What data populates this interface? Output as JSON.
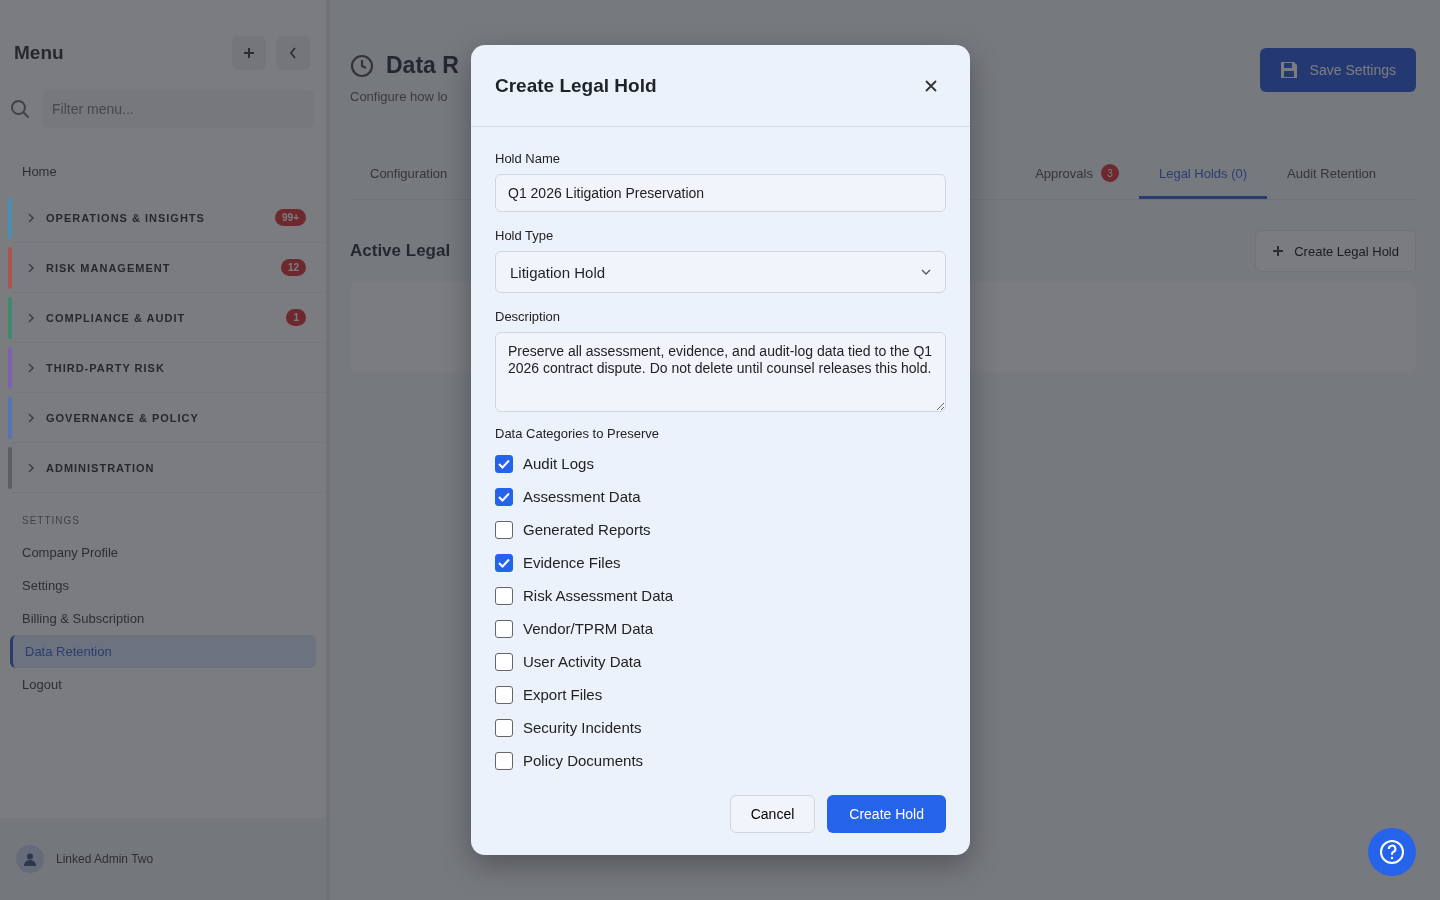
{
  "sidebar": {
    "title": "Menu",
    "filter": {
      "placeholder": "Filter menu..."
    },
    "home": "Home",
    "groups": [
      {
        "label": "OPERATIONS & INSIGHTS",
        "color": "#4a8db5",
        "badge": "99+"
      },
      {
        "label": "RISK MANAGEMENT",
        "color": "#b0504f",
        "badge": "12"
      },
      {
        "label": "COMPLIANCE & AUDIT",
        "color": "#3f8a6c",
        "badge": "1"
      },
      {
        "label": "THIRD-PARTY RISK",
        "color": "#7a62b0"
      },
      {
        "label": "GOVERNANCE & POLICY",
        "color": "#5673b8"
      },
      {
        "label": "ADMINISTRATION",
        "color": "#5a5e66"
      }
    ],
    "settings_heading": "SETTINGS",
    "links": [
      {
        "label": "Company Profile",
        "selected": false
      },
      {
        "label": "Settings",
        "selected": false
      },
      {
        "label": "Billing & Subscription",
        "selected": false
      },
      {
        "label": "Data Retention",
        "selected": true
      },
      {
        "label": "Logout",
        "selected": false
      }
    ],
    "user": "Linked Admin Two"
  },
  "page": {
    "title": "Data R",
    "subtitle": "Configure how lo",
    "save_button": "Save Settings",
    "tabs": [
      {
        "label": "Configuration",
        "selected": false
      },
      {
        "label": "Approvals",
        "badge": "3",
        "selected": false
      },
      {
        "label": "Legal Holds (0)",
        "selected": true
      },
      {
        "label": "Audit Retention",
        "selected": false
      }
    ],
    "section_title": "Active Legal",
    "create_button": "Create Legal Hold"
  },
  "modal": {
    "title": "Create Legal Hold",
    "hold_name": {
      "label": "Hold Name",
      "value": "Q1 2026 Litigation Preservation"
    },
    "hold_type": {
      "label": "Hold Type",
      "value": "Litigation Hold"
    },
    "description": {
      "label": "Description",
      "value": "Preserve all assessment, evidence, and audit-log data tied to the Q1 2026 contract dispute. Do not delete until counsel releases this hold."
    },
    "categories_label": "Data Categories to Preserve",
    "categories": [
      {
        "label": "Audit Logs",
        "checked": true
      },
      {
        "label": "Assessment Data",
        "checked": true
      },
      {
        "label": "Generated Reports",
        "checked": false
      },
      {
        "label": "Evidence Files",
        "checked": true
      },
      {
        "label": "Risk Assessment Data",
        "checked": false
      },
      {
        "label": "Vendor/TPRM Data",
        "checked": false
      },
      {
        "label": "User Activity Data",
        "checked": false
      },
      {
        "label": "Export Files",
        "checked": false
      },
      {
        "label": "Security Incidents",
        "checked": false
      },
      {
        "label": "Policy Documents",
        "checked": false
      }
    ],
    "buttons": [
      "Cancel",
      "Create Hold"
    ]
  }
}
